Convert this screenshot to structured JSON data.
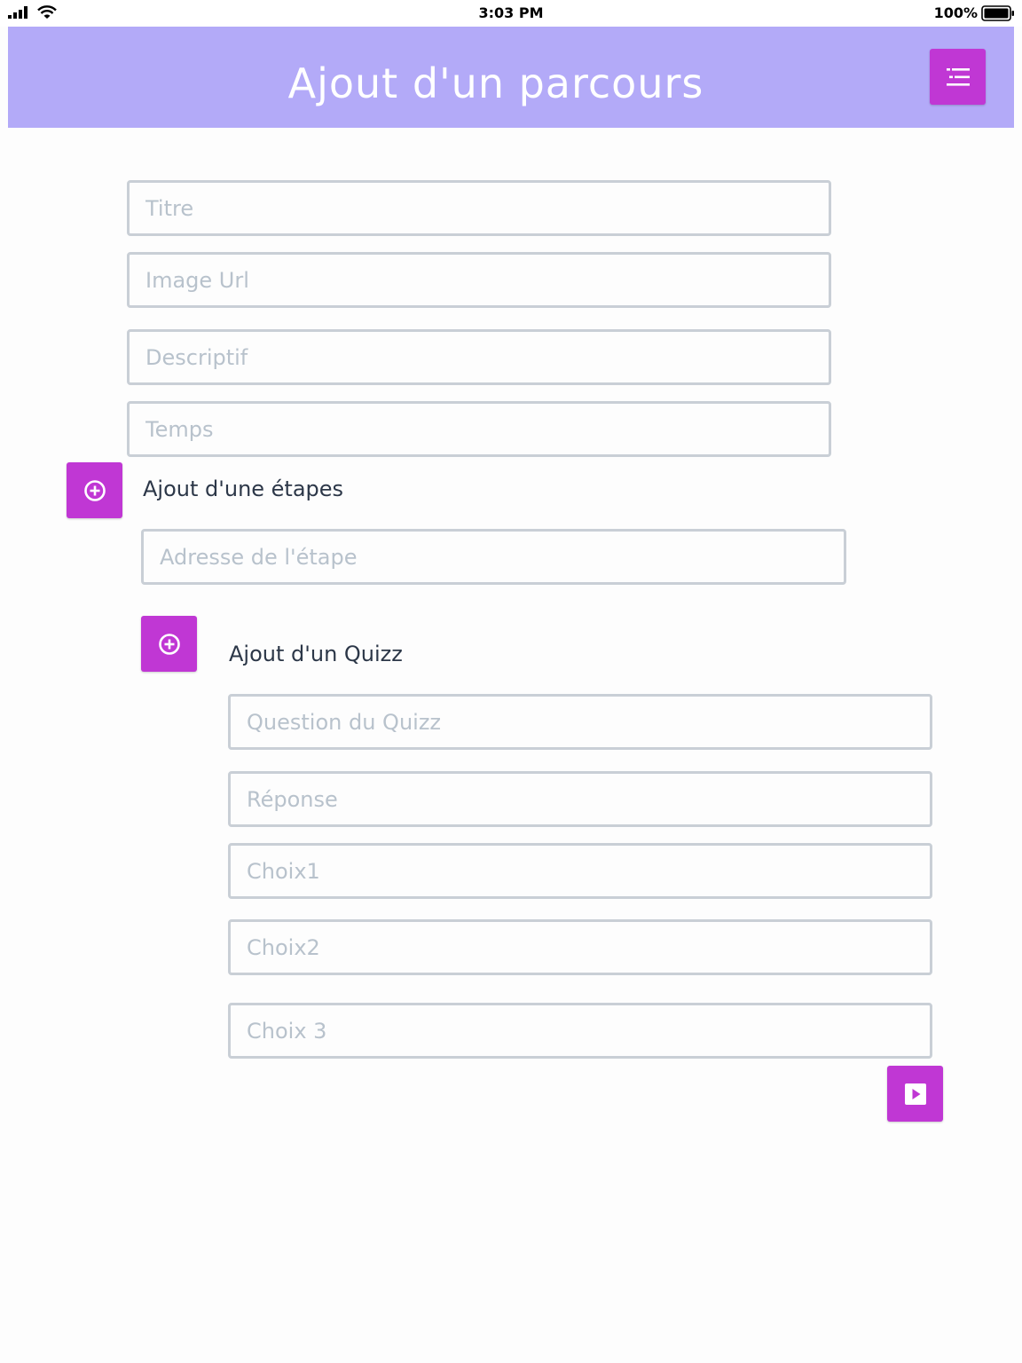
{
  "status_bar": {
    "time": "3:03 PM",
    "battery": "100%",
    "signal_icon": "cellular-signal-icon",
    "wifi_icon": "wifi-icon",
    "battery_icon": "battery-icon"
  },
  "header": {
    "title": "Ajout d'un parcours",
    "menu_icon": "menu-lines-icon",
    "background": "#b3aaf8"
  },
  "accent_color": "#c037d4",
  "parcours_form": {
    "titre": {
      "value": "",
      "placeholder": "Titre"
    },
    "image_url": {
      "value": "",
      "placeholder": "Image Url"
    },
    "descriptif": {
      "value": "",
      "placeholder": "Descriptif"
    },
    "temps": {
      "value": "",
      "placeholder": "Temps"
    }
  },
  "etape_section": {
    "label": "Ajout d'une étapes",
    "add_icon": "plus-circle-icon",
    "adresse": {
      "value": "",
      "placeholder": "Adresse de l'étape"
    }
  },
  "quizz_section": {
    "label": "Ajout d'un Quizz",
    "add_icon": "plus-circle-icon",
    "question": {
      "value": "",
      "placeholder": "Question du Quizz"
    },
    "reponse": {
      "value": "",
      "placeholder": "Réponse"
    },
    "choix1": {
      "value": "",
      "placeholder": "Choix1"
    },
    "choix2": {
      "value": "",
      "placeholder": "Choix2"
    },
    "choix3": {
      "value": "",
      "placeholder": "Choix 3"
    }
  },
  "submit": {
    "icon": "play-square-icon"
  }
}
